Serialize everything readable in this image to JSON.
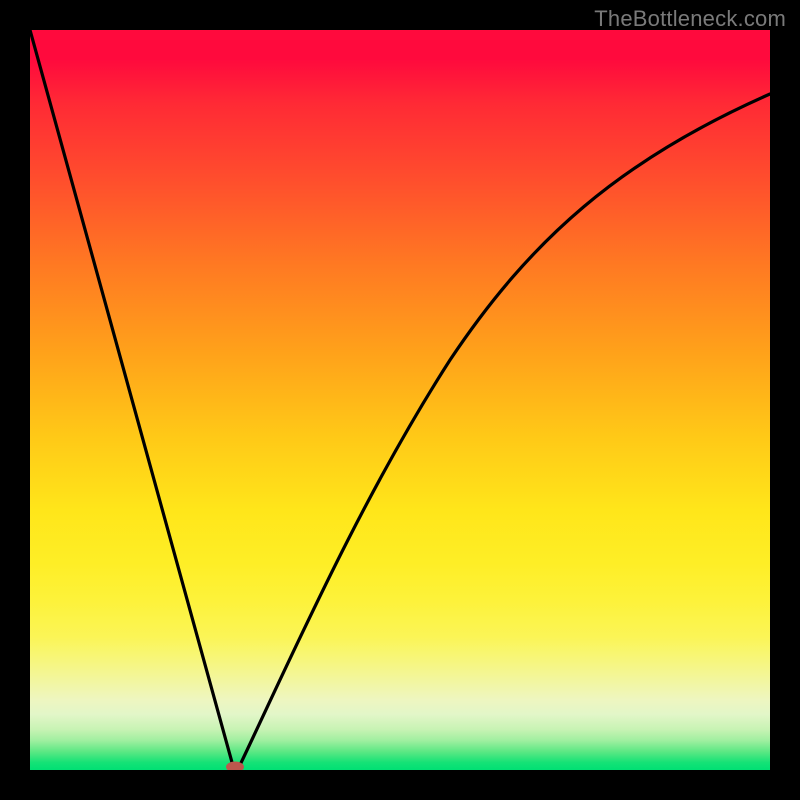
{
  "watermark": {
    "text": "TheBottleneck.com"
  },
  "chart_data": {
    "type": "line",
    "title": "",
    "xlabel": "",
    "ylabel": "",
    "xlim": [
      0,
      100
    ],
    "ylim": [
      0,
      100
    ],
    "grid": false,
    "legend": false,
    "series": [
      {
        "name": "bottleneck-curve",
        "x": [
          0,
          2,
          4,
          6,
          8,
          10,
          12,
          14,
          16,
          18,
          20,
          22,
          24,
          25,
          26,
          27,
          27.5,
          28,
          30,
          32,
          34,
          36,
          38,
          40,
          44,
          48,
          52,
          56,
          60,
          64,
          68,
          72,
          76,
          80,
          84,
          88,
          92,
          96,
          100
        ],
        "y": [
          100,
          93,
          86,
          79,
          72,
          64,
          57,
          50,
          42,
          35,
          28,
          20,
          12,
          8,
          4,
          1.5,
          0.5,
          1.5,
          8,
          16,
          24,
          32,
          39,
          45,
          55,
          63,
          69,
          74,
          78,
          81,
          83.5,
          85.5,
          87,
          88.3,
          89.3,
          90,
          90.6,
          91,
          91.3
        ]
      }
    ],
    "marker": {
      "x": 27.5,
      "y": 0.5,
      "color": "#bd574d"
    },
    "background_gradient": {
      "top": "#ff0a3d",
      "mid": "#ffd21a",
      "bottom": "#00e074"
    }
  }
}
